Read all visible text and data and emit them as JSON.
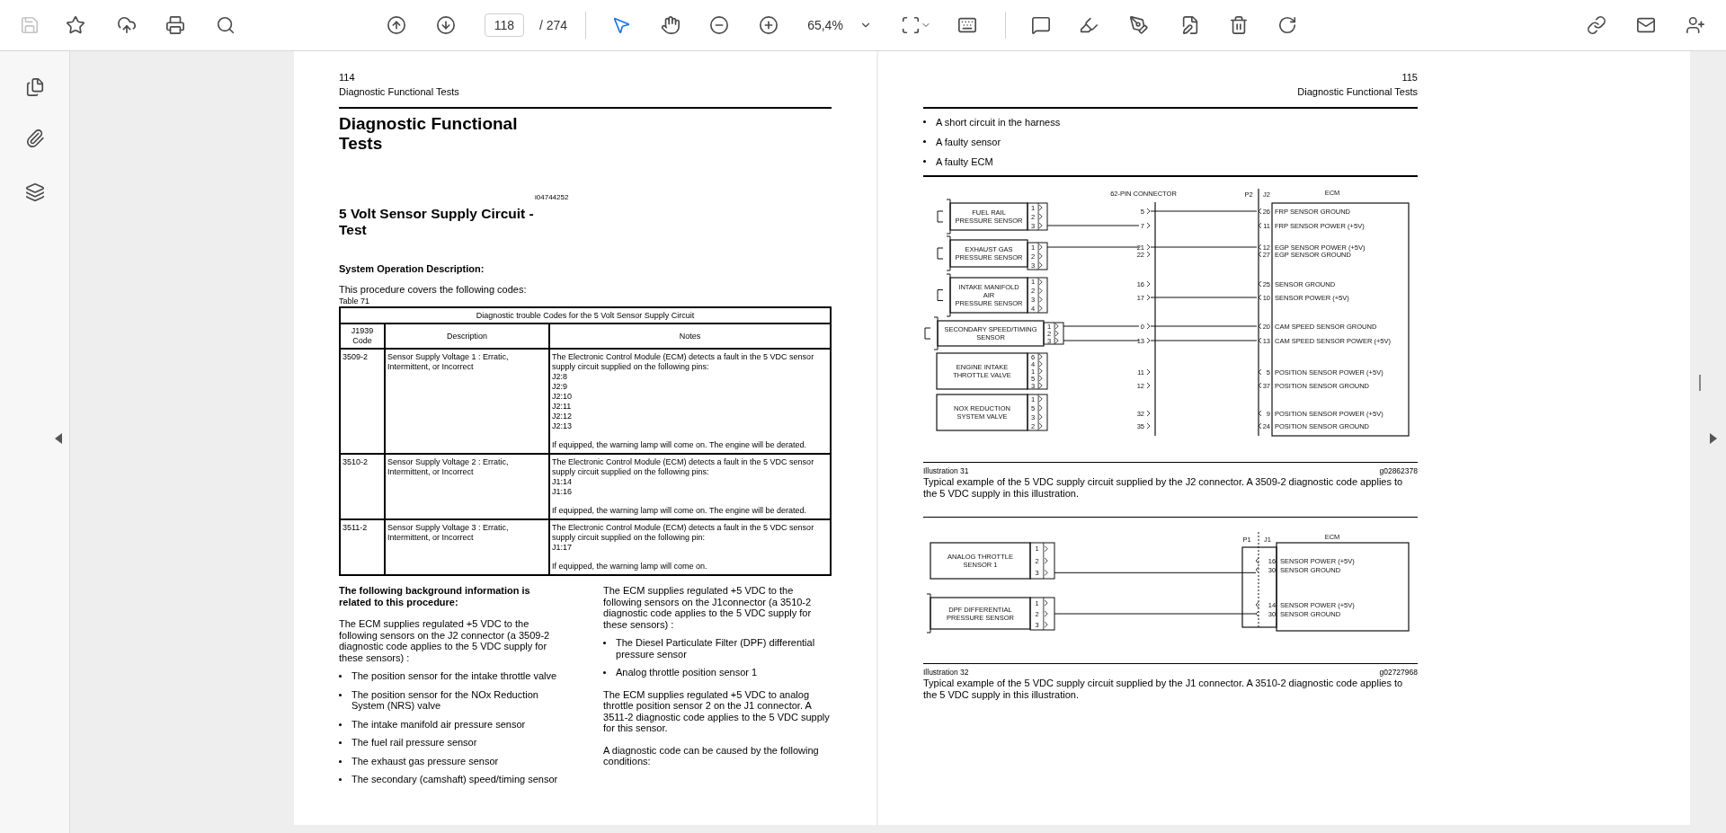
{
  "toolbar": {
    "save": {
      "disabled": true
    },
    "tools": {
      "select": {
        "selected": true
      },
      "hand": {
        "selected": false
      }
    },
    "page_current": "118",
    "page_total": "/ 274",
    "zoom": "65,4%"
  },
  "left_page": {
    "page_number": "114",
    "running_header": "Diagnostic Functional Tests",
    "title": "Diagnostic Functional Tests",
    "doc_id": "i04744252",
    "section_title": "5 Volt Sensor Supply Circuit - Test",
    "subheading": "System Operation Description:",
    "intro": "This procedure covers the following codes:",
    "table_label": "Table 71",
    "table": {
      "caption": "Diagnostic trouble Codes for the 5 Volt Sensor Supply Circuit",
      "columns": [
        "J1939 Code",
        "Description",
        "Notes"
      ],
      "rows": [
        {
          "code": "3509-2",
          "description": "Sensor Supply Voltage 1 : Erratic, Intermittent, or Incorrect",
          "notes": {
            "text": "The Electronic Control Module (ECM) detects a fault in the 5 VDC sensor supply circuit supplied on the following pins:",
            "pins": [
              "J2:8",
              "J2:9",
              "J2:10",
              "J2:11",
              "J2:12",
              "J2:13"
            ],
            "warning": "If equipped, the warning lamp will come on. The engine will be derated."
          }
        },
        {
          "code": "3510-2",
          "description": "Sensor Supply Voltage 2 : Erratic, Intermittent, or Incorrect",
          "notes": {
            "text": "The Electronic Control Module (ECM) detects a fault in the 5 VDC sensor supply circuit supplied on the following pins:",
            "pins": [
              "J1:14",
              "J1:16"
            ],
            "warning": "If equipped, the warning lamp will come on. The engine will be derated."
          }
        },
        {
          "code": "3511-2",
          "description": "Sensor Supply Voltage 3 : Erratic, Intermittent, or Incorrect",
          "notes": {
            "text": "The Electronic Control Module (ECM) detects a fault in the 5 VDC sensor supply circuit supplied on the following pin:",
            "pins": [
              "J1:17"
            ],
            "warning": "If equipped, the warning lamp will come on."
          }
        }
      ]
    },
    "background_heading": "The following background information is related to this procedure:",
    "paragraph_1": "The ECM supplies regulated +5 VDC to the following sensors on the J2 connector (a 3509-2 diagnostic code applies to the 5 VDC supply for these sensors) :",
    "bullets_1": [
      "The position sensor for the intake throttle valve",
      "The position sensor for the NOx Reduction System (NRS) valve",
      "The intake manifold air pressure sensor",
      "The fuel rail pressure sensor",
      "The exhaust gas pressure sensor",
      "The secondary (camshaft) speed/timing sensor"
    ],
    "paragraph_2": "The ECM supplies regulated +5 VDC to the following sensors on the J1connector (a 3510-2 diagnostic code applies to the 5 VDC supply for these sensors) :",
    "bullets_2": [
      "The Diesel Particulate Filter (DPF) differential pressure sensor",
      "Analog throttle position sensor 1"
    ],
    "paragraph_3": "The ECM supplies regulated +5 VDC to analog throttle position sensor 2 on the J1 connector. A 3511-2 diagnostic code applies to the 5 VDC supply for this sensor.",
    "paragraph_4": "A diagnostic code can be caused by the following conditions:"
  },
  "right_page": {
    "page_number": "115",
    "running_header": "Diagnostic Functional Tests",
    "bullets": [
      "A short circuit in the harness",
      "A faulty sensor",
      "A faulty ECM"
    ],
    "diagram_1": {
      "connector_label": "62-PIN CONNECTOR",
      "plug_label": "P2",
      "jack_label": "J2",
      "ecm_label": "ECM",
      "sensors": [
        {
          "name_lines": [
            "FUEL RAIL",
            "PRESSURE SENSOR"
          ],
          "pins": [
            {
              "label": "1",
              "wired": false
            },
            {
              "label": "2",
              "wired": false
            },
            {
              "label": "3",
              "wired": true
            }
          ]
        },
        {
          "name_lines": [
            "EXHAUST GAS",
            "PRESSURE SENSOR"
          ],
          "pins": [
            {
              "label": "1",
              "wired": true
            },
            {
              "label": "2",
              "wired": false
            },
            {
              "label": "3",
              "wired": false
            }
          ]
        },
        {
          "name_lines": [
            "INTAKE MANIFOLD",
            "AIR",
            "PRESSURE SENSOR"
          ],
          "pins": [
            {
              "label": "1",
              "wired": false
            },
            {
              "label": "2",
              "wired": false
            },
            {
              "label": "3",
              "wired": false
            },
            {
              "label": "4",
              "wired": false
            }
          ]
        },
        {
          "name_lines": [
            "SECONDARY SPEED/TIMING",
            "SENSOR"
          ],
          "pins": [
            {
              "label": "1",
              "wired": true
            },
            {
              "label": "2",
              "wired": false
            },
            {
              "label": "3",
              "wired": true
            }
          ]
        },
        {
          "name_lines": [
            "ENGINE INTAKE",
            "THROTTLE VALVE"
          ],
          "pins": [
            {
              "label": "6",
              "wired": false
            },
            {
              "label": "4",
              "wired": false
            },
            {
              "label": "1",
              "wired": false
            },
            {
              "label": "5",
              "wired": false
            },
            {
              "label": "3",
              "wired": false
            }
          ]
        },
        {
          "name_lines": [
            "NOX REDUCTION",
            "SYSTEM VALVE"
          ],
          "pins": [
            {
              "label": "1",
              "wired": false
            },
            {
              "label": "5",
              "wired": false
            },
            {
              "label": "3",
              "wired": false
            },
            {
              "label": "2",
              "wired": false
            }
          ]
        }
      ],
      "circuits": [
        {
          "connector_pin": "5",
          "ecm_pin": "26",
          "ecm_label": "FRP SENSOR GROUND",
          "wired": true
        },
        {
          "connector_pin": "7",
          "ecm_pin": "11",
          "ecm_label": "FRP SENSOR POWER (+5V)",
          "wired": false
        },
        {
          "connector_pin": "21",
          "ecm_pin": "12",
          "ecm_label": "EGP SENSOR POWER (+5V)",
          "wired": true
        },
        {
          "connector_pin": "22",
          "ecm_pin": "27",
          "ecm_label": "EGP SENSOR GROUND",
          "wired": false
        },
        {
          "connector_pin": "16",
          "ecm_pin": "25",
          "ecm_label": "SENSOR GROUND",
          "wired": false
        },
        {
          "connector_pin": "17",
          "ecm_pin": "10",
          "ecm_label": "SENSOR POWER (+5V)",
          "wired": true
        },
        {
          "connector_pin": "0",
          "ecm_pin": "20",
          "ecm_label": "CAM SPEED SENSOR GROUND",
          "wired": true
        },
        {
          "connector_pin": "13",
          "ecm_pin": "13",
          "ecm_label": "CAM SPEED SENSOR POWER (+5V)",
          "wired": true
        },
        {
          "connector_pin": "11",
          "ecm_pin": "5",
          "ecm_label": "POSITION SENSOR POWER (+5V)",
          "wired": false
        },
        {
          "connector_pin": "12",
          "ecm_pin": "37",
          "ecm_label": "POSITION SENSOR GROUND",
          "wired": false
        },
        {
          "connector_pin": "32",
          "ecm_pin": "9",
          "ecm_label": "POSITION SENSOR POWER (+5V)",
          "wired": false
        },
        {
          "connector_pin": "35",
          "ecm_pin": "24",
          "ecm_label": "POSITION SENSOR GROUND",
          "wired": false
        }
      ]
    },
    "illustration_1": {
      "label": "Illustration 31",
      "ref": "g02862378",
      "caption": "Typical example of the 5 VDC supply circuit supplied by the J2 connector. A 3509-2 diagnostic code applies to the 5 VDC supply in this illustration."
    },
    "diagram_2": {
      "plug_label": "P1",
      "jack_label": "J1",
      "ecm_label": "ECM",
      "sensors": [
        {
          "name_lines": [
            "ANALOG THROTTLE",
            "SENSOR 1"
          ],
          "pins": [
            {
              "label": "1",
              "wired": false
            },
            {
              "label": "2",
              "wired": false
            },
            {
              "label": "3",
              "wired": true
            }
          ]
        },
        {
          "name_lines": [
            "DPF DIFFERENTIAL",
            "PRESSURE SENSOR"
          ],
          "pins": [
            {
              "label": "1",
              "wired": false
            },
            {
              "label": "2",
              "wired": true
            },
            {
              "label": "3",
              "wired": false
            }
          ]
        }
      ],
      "circuits": [
        {
          "ecm_pin": "16",
          "ecm_label": "SENSOR POWER (+5V)"
        },
        {
          "ecm_pin": "30",
          "ecm_label": "SENSOR GROUND"
        },
        {
          "ecm_pin": "14",
          "ecm_label": "SENSOR POWER (+5V)"
        },
        {
          "ecm_pin": "30",
          "ecm_label": "SENSOR GROUND"
        }
      ]
    },
    "illustration_2": {
      "label": "Illustration 32",
      "ref": "g02727968",
      "caption": "Typical example of the 5 VDC supply circuit supplied by the J1 connector. A 3510-2 diagnostic code applies to the 5 VDC supply in this illustration."
    }
  }
}
